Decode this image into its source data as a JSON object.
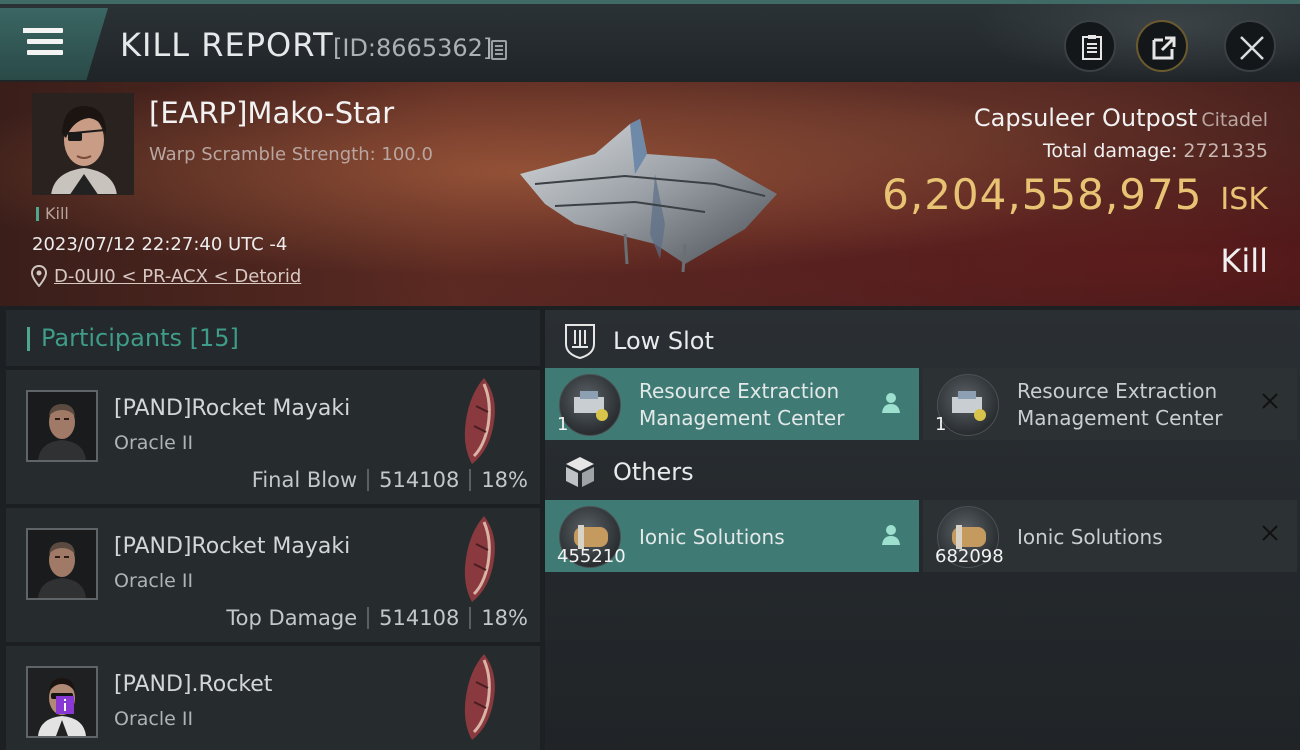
{
  "header": {
    "title": "KILL REPORT",
    "report_id": "[ID:8665362]"
  },
  "victim": {
    "name": "[EARP]Mako-Star",
    "warp_scramble": "Warp Scramble Strength: 100.0",
    "kill_tag": "Kill",
    "datetime": "2023/07/12 22:27:40 UTC -4",
    "location": "D-0UI0 < PR-ACX < Detorid",
    "ship_name": "Capsuleer Outpost",
    "ship_class": "Citadel",
    "total_damage_label": "Total damage:",
    "total_damage_value": "2721335",
    "isk_amount": "6,204,558,975",
    "isk_unit": "ISK",
    "result_label": "Kill"
  },
  "participants": {
    "label": "Participants",
    "count": "[15]",
    "rows": [
      {
        "name": "[PAND]Rocket Mayaki",
        "ship": "Oracle II",
        "role": "Final Blow",
        "damage": "514108",
        "percent": "18%"
      },
      {
        "name": "[PAND]Rocket Mayaki",
        "ship": "Oracle II",
        "role": "Top Damage",
        "damage": "514108",
        "percent": "18%"
      },
      {
        "name": "[PAND].Rocket",
        "ship": "Oracle II"
      }
    ]
  },
  "fitting": {
    "low_slot": {
      "label": "Low Slot",
      "items": [
        {
          "name_line1": "Resource Extraction",
          "name_line2": "Management Center",
          "qty": "1",
          "status": "dropped"
        },
        {
          "name_line1": "Resource Extraction",
          "name_line2": "Management Center",
          "qty": "1",
          "status": "destroyed"
        }
      ]
    },
    "others": {
      "label": "Others",
      "items": [
        {
          "name": "Ionic Solutions",
          "qty": "455210",
          "status": "dropped"
        },
        {
          "name": "Ionic Solutions",
          "qty": "682098",
          "status": "destroyed"
        }
      ]
    }
  },
  "colors": {
    "accent_teal": "#3f7b74",
    "isk_gold": "#e7c373",
    "participants_teal": "#3e9c88"
  },
  "icons": [
    "menu-icon",
    "copy-icon",
    "clipboard-icon",
    "export-icon",
    "close-icon",
    "location-pin-icon",
    "low-slot-icon",
    "cube-icon",
    "person-icon",
    "x-icon"
  ]
}
